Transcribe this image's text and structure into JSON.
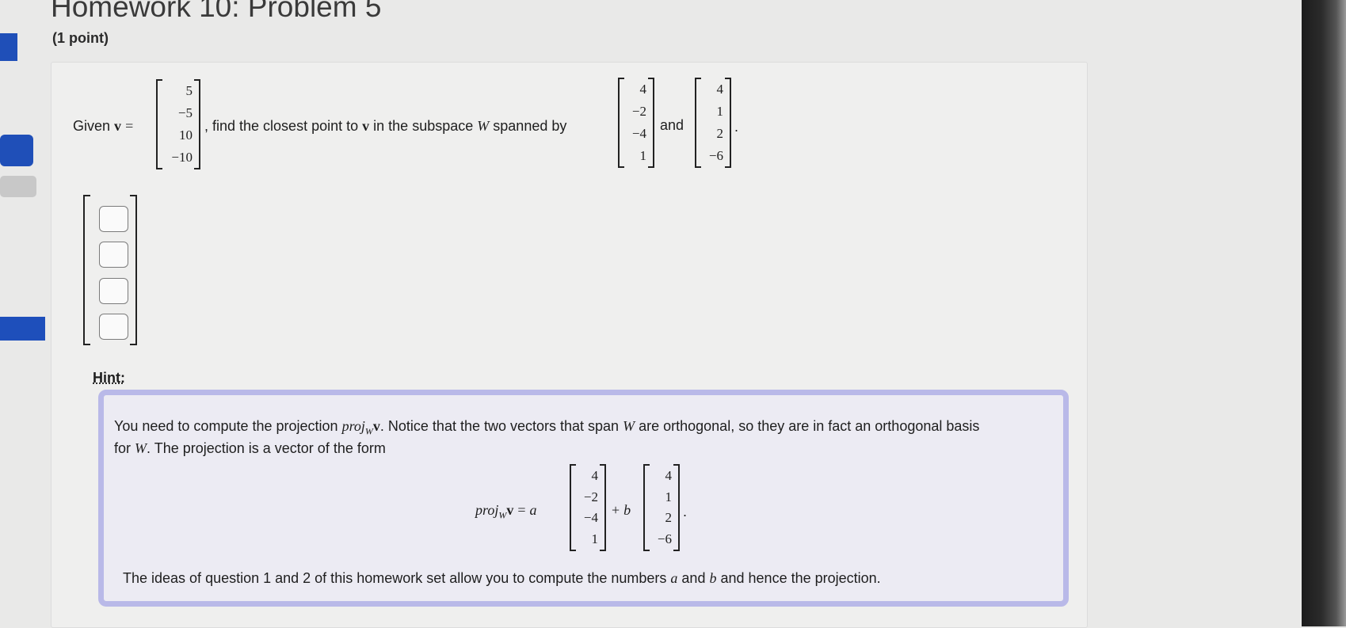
{
  "page": {
    "title": "Homework 10: Problem 5",
    "points": "(1 point)"
  },
  "problem": {
    "given_label": "Given",
    "v_symbol": "v",
    "equals": "=",
    "v": [
      "5",
      "−5",
      "10",
      "−10"
    ],
    "text_mid": ", find the closest point to",
    "text_subspace": "in the subspace",
    "W_symbol": "W",
    "text_spanned": "spanned by",
    "and": "and",
    "period": ".",
    "u1": [
      "4",
      "−2",
      "−4",
      "1"
    ],
    "u2": [
      "4",
      "1",
      "2",
      "−6"
    ]
  },
  "answer": {
    "fields": [
      "",
      "",
      "",
      ""
    ]
  },
  "hint": {
    "label": "Hint:",
    "p1_a": "You need to compute the projection",
    "proj": "proj",
    "proj_sub": "W",
    "p1_b": ". Notice that the two vectors that span",
    "p1_c": "are orthogonal, so they are in fact an orthogonal basis",
    "p2_a": "for",
    "p2_b": ". The projection is a vector of the form",
    "eq_equals": "=",
    "eq_a": "a",
    "eq_plus": "+",
    "eq_b": "b",
    "eq_end": ".",
    "p3_a": "The ideas of question 1 and 2 of this homework set allow you to compute the numbers",
    "p3_and": "and",
    "p3_b": "and hence the projection."
  }
}
